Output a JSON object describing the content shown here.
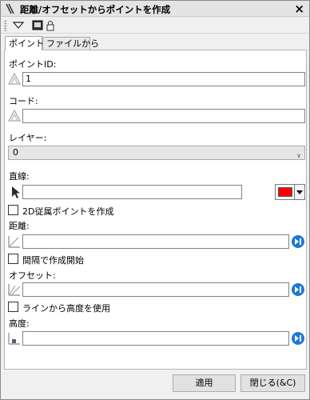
{
  "window": {
    "title": "距離/オフセットからポイントを作成",
    "close_glyph": "×"
  },
  "tabs": [
    {
      "label": "ポイント",
      "active": true
    },
    {
      "label": "ファイルから",
      "active": false
    }
  ],
  "form": {
    "point_id": {
      "label": "ポイントID:",
      "value": "1"
    },
    "code": {
      "label": "コード:",
      "value": ""
    },
    "layer": {
      "label": "レイヤー:",
      "selected": "0"
    },
    "line": {
      "label": "直線:",
      "value": "",
      "color": "#ff0000"
    },
    "create_2d": {
      "label": "2D従属ポイントを作成",
      "checked": false
    },
    "distance": {
      "label": "距離:",
      "value": ""
    },
    "start_at_interval": {
      "label": "間隔で作成開始",
      "checked": false
    },
    "offset": {
      "label": "オフセット:",
      "value": ""
    },
    "use_line_elevation": {
      "label": "ラインから高度を使用",
      "checked": false
    },
    "elevation": {
      "label": "高度:",
      "value": ""
    }
  },
  "buttons": {
    "apply": "適用",
    "close": "閉じる(&C)"
  },
  "colors": {
    "accent_blue": "#1e78d2",
    "line_color": "#ff0000"
  }
}
